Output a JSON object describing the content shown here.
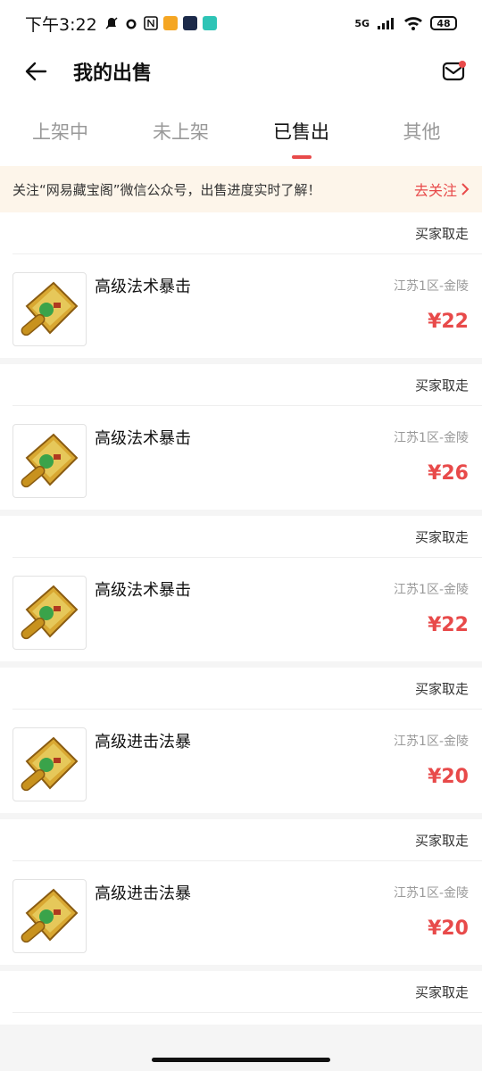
{
  "status_bar": {
    "time": "下午3:22",
    "network": "5G",
    "battery": "48"
  },
  "header": {
    "title": "我的出售"
  },
  "tabs": [
    {
      "label": "上架中"
    },
    {
      "label": "未上架"
    },
    {
      "label": "已售出"
    },
    {
      "label": "其他"
    }
  ],
  "active_tab": "已售出",
  "banner": {
    "text": "关注“网易藏宝阁”微信公众号，出售进度实时了解！",
    "link": "去关注"
  },
  "orders": [
    {
      "status": "买家取走",
      "name": "高级法术暴击",
      "server": "江苏1区-金陵",
      "price": "¥22"
    },
    {
      "status": "买家取走",
      "name": "高级法术暴击",
      "server": "江苏1区-金陵",
      "price": "¥26"
    },
    {
      "status": "买家取走",
      "name": "高级法术暴击",
      "server": "江苏1区-金陵",
      "price": "¥22"
    },
    {
      "status": "买家取走",
      "name": "高级进击法暴",
      "server": "江苏1区-金陵",
      "price": "¥20"
    },
    {
      "status": "买家取走",
      "name": "高级进击法暴",
      "server": "江苏1区-金陵",
      "price": "¥20"
    },
    {
      "status": "买家取走"
    }
  ],
  "colors": {
    "accent": "#e84a4a",
    "banner_bg": "#fdf5ea"
  }
}
